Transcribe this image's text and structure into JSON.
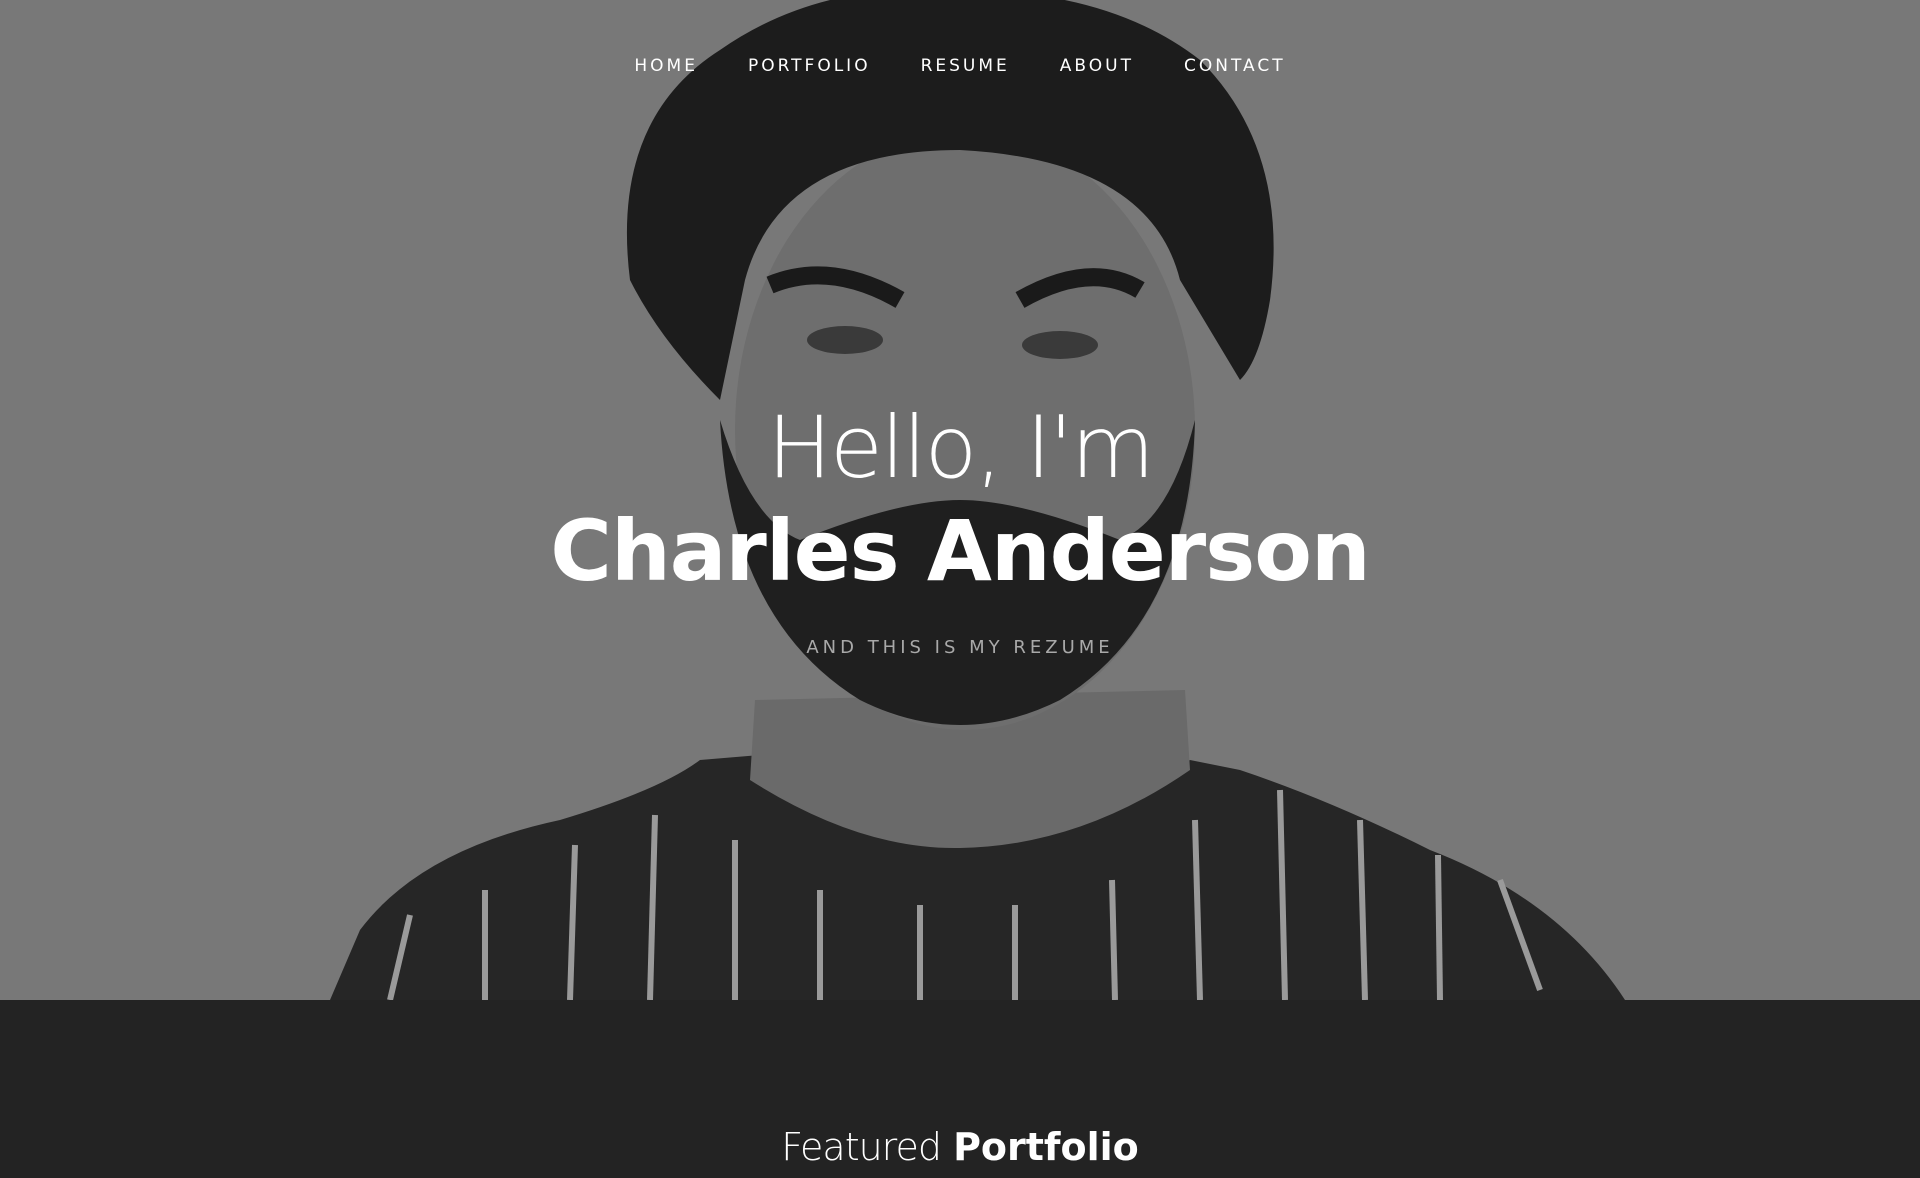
{
  "nav": {
    "items": [
      {
        "label": "HOME"
      },
      {
        "label": "PORTFOLIO"
      },
      {
        "label": "RESUME"
      },
      {
        "label": "ABOUT"
      },
      {
        "label": "CONTACT"
      }
    ]
  },
  "hero": {
    "greeting": "Hello, I'm",
    "name": "Charles Anderson",
    "subtitle": "AND THIS IS MY REZUME",
    "image": "portrait-photo-grayscale"
  },
  "featured": {
    "light": "Featured",
    "bold": "Portfolio"
  },
  "colors": {
    "hero_background": "#787878",
    "section_background": "#232323",
    "text": "#ffffff",
    "subtitle": "#a9a9a9"
  }
}
